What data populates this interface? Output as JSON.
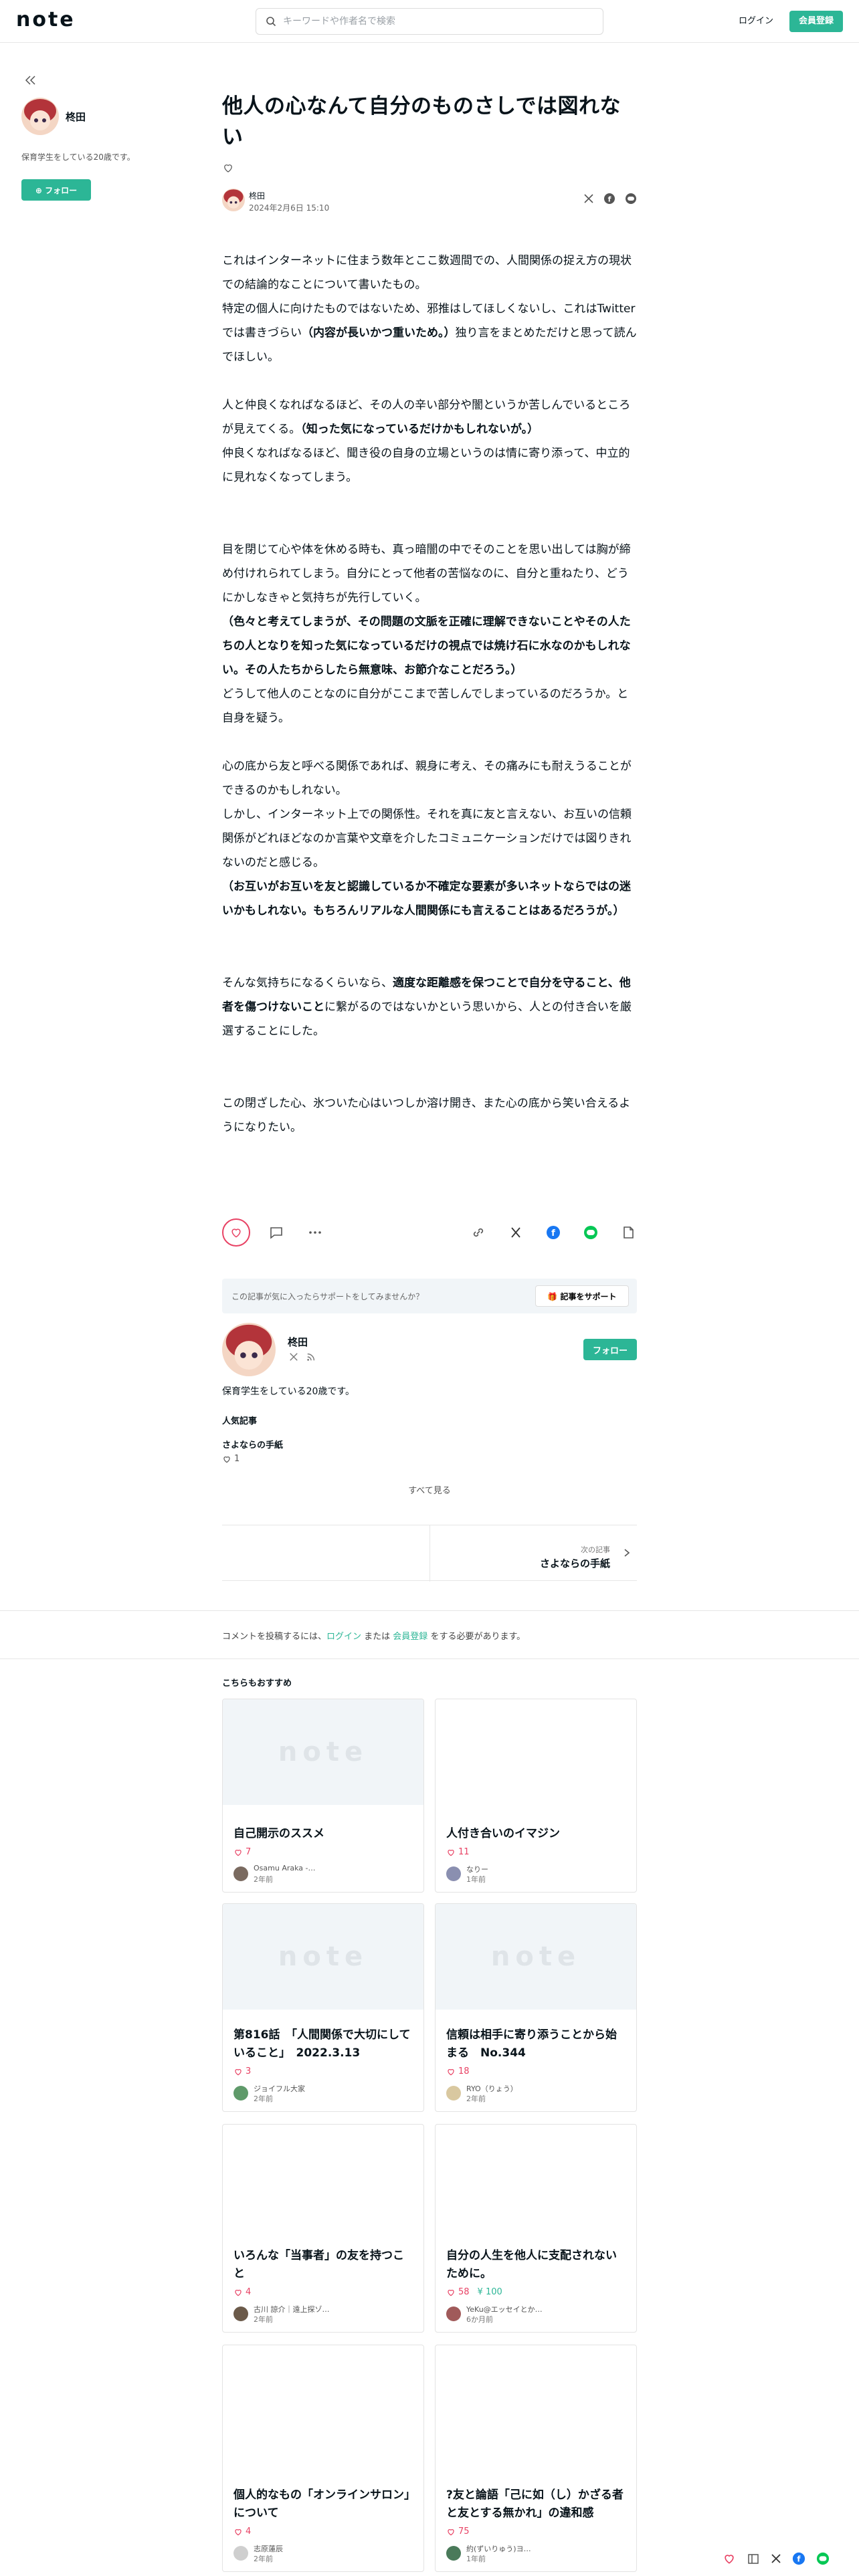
{
  "header": {
    "logo": "note",
    "search_placeholder": "キーワードや作者名で検索",
    "login_label": "ログイン",
    "register_label": "会員登録"
  },
  "sidebar": {
    "name": "柊田",
    "bio": "保育学生をしている20歳です。",
    "follow_label": "フォロー"
  },
  "article": {
    "title": "他人の心なんて自分のものさしでは図れない",
    "author": "柊田",
    "date": "2024年2月6日 15:10",
    "paragraphs": [
      [
        {
          "t": "これはインターネットに住まう数年とここ数週間での、人間関係の捉え方の現状での結論的なことについて書いたもの。"
        }
      ],
      [
        {
          "t": "特定の個人に向けたものではないため、邪推はしてほしくないし、これはTwitterでは書きづらい"
        },
        {
          "t": "（内容が長いかつ重いため。）",
          "b": true
        },
        {
          "t": "独り言をまとめただけと思って読んでほしい。"
        }
      ],
      "gap",
      [
        {
          "t": "人と仲良くなればなるほど、その人の辛い部分や闇というか苦しんでいるところが見えてくる。"
        },
        {
          "t": "（知った気になっているだけかもしれないが。）",
          "b": true
        }
      ],
      [
        {
          "t": "仲良くなればなるほど、聞き役の自身の立場というのは情に寄り添って、中立的に見れなくなってしまう。"
        }
      ],
      "gap",
      "gap",
      [
        {
          "t": "目を閉じて心や体を休める時も、真っ暗闇の中でそのことを思い出しては胸が締め付けれられてしまう。自分にとって他者の苦悩なのに、自分と重ねたり、どうにかしなきゃと気持ちが先行していく。"
        }
      ],
      [
        {
          "t": "（色々と考えてしまうが、その問題の文脈を正確に理解できないことやその人たちの人となりを知った気になっているだけの視点では焼け石に水なのかもしれない。その人たちからしたら無意味、お節介なことだろう。）",
          "b": true
        }
      ],
      [
        {
          "t": "どうして他人のことなのに自分がここまで苦しんでしまっているのだろうか。と自身を疑う。"
        }
      ],
      "gap",
      [
        {
          "t": "心の底から友と呼べる関係であれば、親身に考え、その痛みにも耐えうることができるのかもしれない。"
        }
      ],
      [
        {
          "t": "しかし、インターネット上での関係性。それを真に友と言えない、お互いの信頼関係がどれほどなのか言葉や文章を介したコミュニケーションだけでは図りきれないのだと感じる。"
        }
      ],
      [
        {
          "t": "（お互いがお互いを友と認識しているか不確定な要素が多いネットならではの迷いかもしれない。もちろんリアルな人間関係にも言えることはあるだろうが。）",
          "b": true
        }
      ],
      "gap",
      "gap",
      [
        {
          "t": "そんな気持ちになるくらいなら、"
        },
        {
          "t": "適度な距離感を保つことで自分を守ること、他者を傷つけないこと",
          "b": true
        },
        {
          "t": "に繋がるのではないかという思いから、人との付き合いを厳選することにした。"
        }
      ],
      "gap",
      "gap",
      [
        {
          "t": "この閉ざした心、氷ついた心はいつしか溶け開き、また心の底から笑い合えるようになりたい。"
        }
      ]
    ]
  },
  "support": {
    "text": "この記事が気に入ったらサポートをしてみませんか？",
    "button": "記事をサポート"
  },
  "profile": {
    "name": "柊田",
    "bio": "保育学生をしている20歳です。",
    "follow_label": "フォロー",
    "popular_heading": "人気記事",
    "popular_title": "さよならの手紙",
    "popular_likes": "1",
    "see_all": "すべて見る"
  },
  "next": {
    "label": "次の記事",
    "title": "さよならの手紙"
  },
  "comment": {
    "prefix": "コメントを投稿するには、",
    "login": "ログイン",
    "middle": " または ",
    "register": "会員登録",
    "suffix": " をする必要があります。"
  },
  "recommend": {
    "heading": "こちらもおすすめ",
    "thumb_text": "note",
    "cards": [
      {
        "title": "自己開示のススメ",
        "likes": "7",
        "author": "Osamu Araka -…",
        "time": "2年前",
        "thumb": true,
        "ava": "#7a6a60"
      },
      {
        "title": "人付き合いのイマジン",
        "likes": "11",
        "author": "なりー",
        "time": "1年前",
        "thumb": false,
        "ava": "#8a8fb0"
      },
      {
        "title": "第816話　「人間関係で大切にしていること」　2022.3.13",
        "likes": "3",
        "author": "ジョイフル大家",
        "time": "2年前",
        "thumb": true,
        "ava": "#5f9a6a"
      },
      {
        "title": "信頼は相手に寄り添うことから始まる　No.344",
        "likes": "18",
        "author": "RYO（りょう）",
        "time": "2年前",
        "thumb": true,
        "ava": "#d9c8a0"
      },
      {
        "title": "いろんな「当事者」の友を持つこと",
        "likes": "4",
        "author": "古川 諒介｜遠上探ゾ…",
        "time": "2年前",
        "thumb": false,
        "ava": "#6b5a4a"
      },
      {
        "title": "自分の人生を他人に支配されないために。",
        "likes": "58",
        "price": "¥ 100",
        "author": "YeKu@エッセイとか…",
        "time": "6か月前",
        "thumb": false,
        "ava": "#a05a5a"
      },
      {
        "title": "個人的なもの「オンラインサロン」について",
        "likes": "4",
        "author": "志原蓮辰",
        "time": "2年前",
        "thumb": false,
        "ava": "#cfcfcf"
      },
      {
        "title": "?友と論語「己に如（し）かざる者と友とする無かれ」の違和感",
        "likes": "75",
        "author": "約(ずいりゅう)ヨ…",
        "time": "1年前",
        "thumb": false,
        "ava": "#4a7a5a"
      }
    ]
  },
  "colors": {
    "accent": "#2cb696",
    "like": "#e84264",
    "text": "#08131a"
  }
}
